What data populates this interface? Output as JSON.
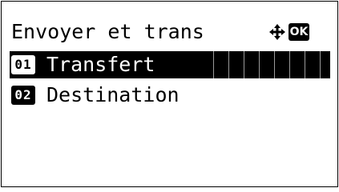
{
  "screen": {
    "title": "Envoyer et trans",
    "nav_icon": "four-way-arrow-icon",
    "ok_label": "OK"
  },
  "menu": {
    "items": [
      {
        "number": "01",
        "label": "Transfert",
        "selected": true
      },
      {
        "number": "02",
        "label": "Destination",
        "selected": false
      }
    ]
  },
  "colors": {
    "foreground": "#000000",
    "background": "#ffffff"
  }
}
